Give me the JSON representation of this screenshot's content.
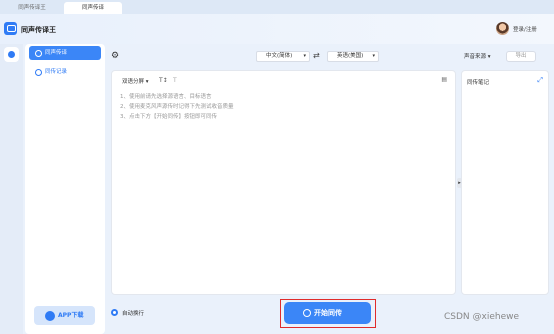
{
  "tabs": [
    {
      "label": "同声传译王"
    },
    {
      "label": "同声传译"
    }
  ],
  "app": {
    "title": "同声传译王",
    "login": "登录/注册"
  },
  "sidebar": {
    "items": [
      {
        "label": "同声传译",
        "active": true,
        "icon": "user-icon"
      },
      {
        "label": "同传记录",
        "active": false,
        "icon": "history-icon"
      }
    ],
    "app_download": "APP下载"
  },
  "toolbar": {
    "source_language": "中文(简体)",
    "target_language": "英语(美国)",
    "voice_source": "声音来源",
    "export": "导出"
  },
  "editor": {
    "mode": "双语分屏",
    "hints": [
      "1、使用前请先选择源语言、目标语言",
      "2、使用麦克风声源传时记得下先测试收音质量",
      "3、点击下方【开始同传】按钮即可同传"
    ]
  },
  "notes": {
    "title": "同传笔记"
  },
  "footer": {
    "auto_wrap": "自动换行",
    "start": "开始同传"
  },
  "watermark": "CSDN @xiehewe",
  "colors": {
    "accent": "#3b86f7",
    "highlight": "#e02b2b"
  }
}
